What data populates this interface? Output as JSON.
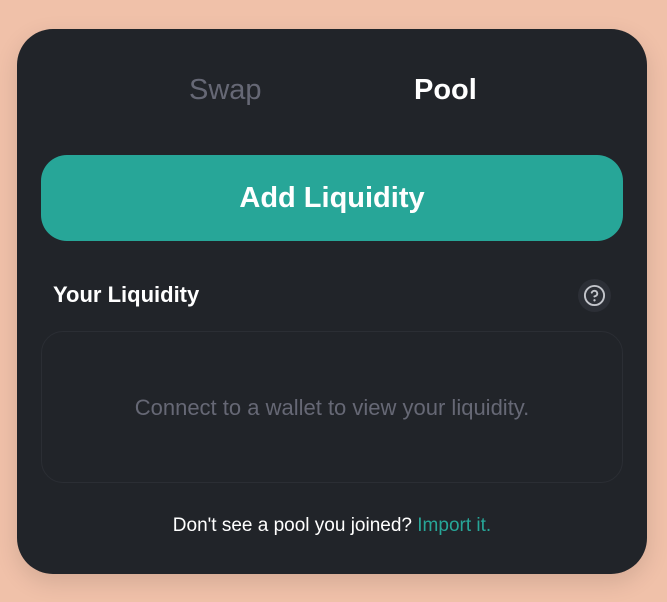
{
  "tabs": {
    "swap": "Swap",
    "pool": "Pool",
    "active": "Pool"
  },
  "actions": {
    "add_liquidity": "Add Liquidity"
  },
  "liquidity": {
    "title": "Your Liquidity",
    "empty_message": "Connect to a wallet to view your liquidity."
  },
  "footer": {
    "prompt": "Don't see a pool you joined?",
    "import_link": "Import it."
  },
  "icons": {
    "help": "question-circle-icon"
  },
  "colors": {
    "page_background": "#f0c1a9",
    "card_background": "#212429",
    "accent": "#27a698",
    "muted_text": "#666875"
  }
}
